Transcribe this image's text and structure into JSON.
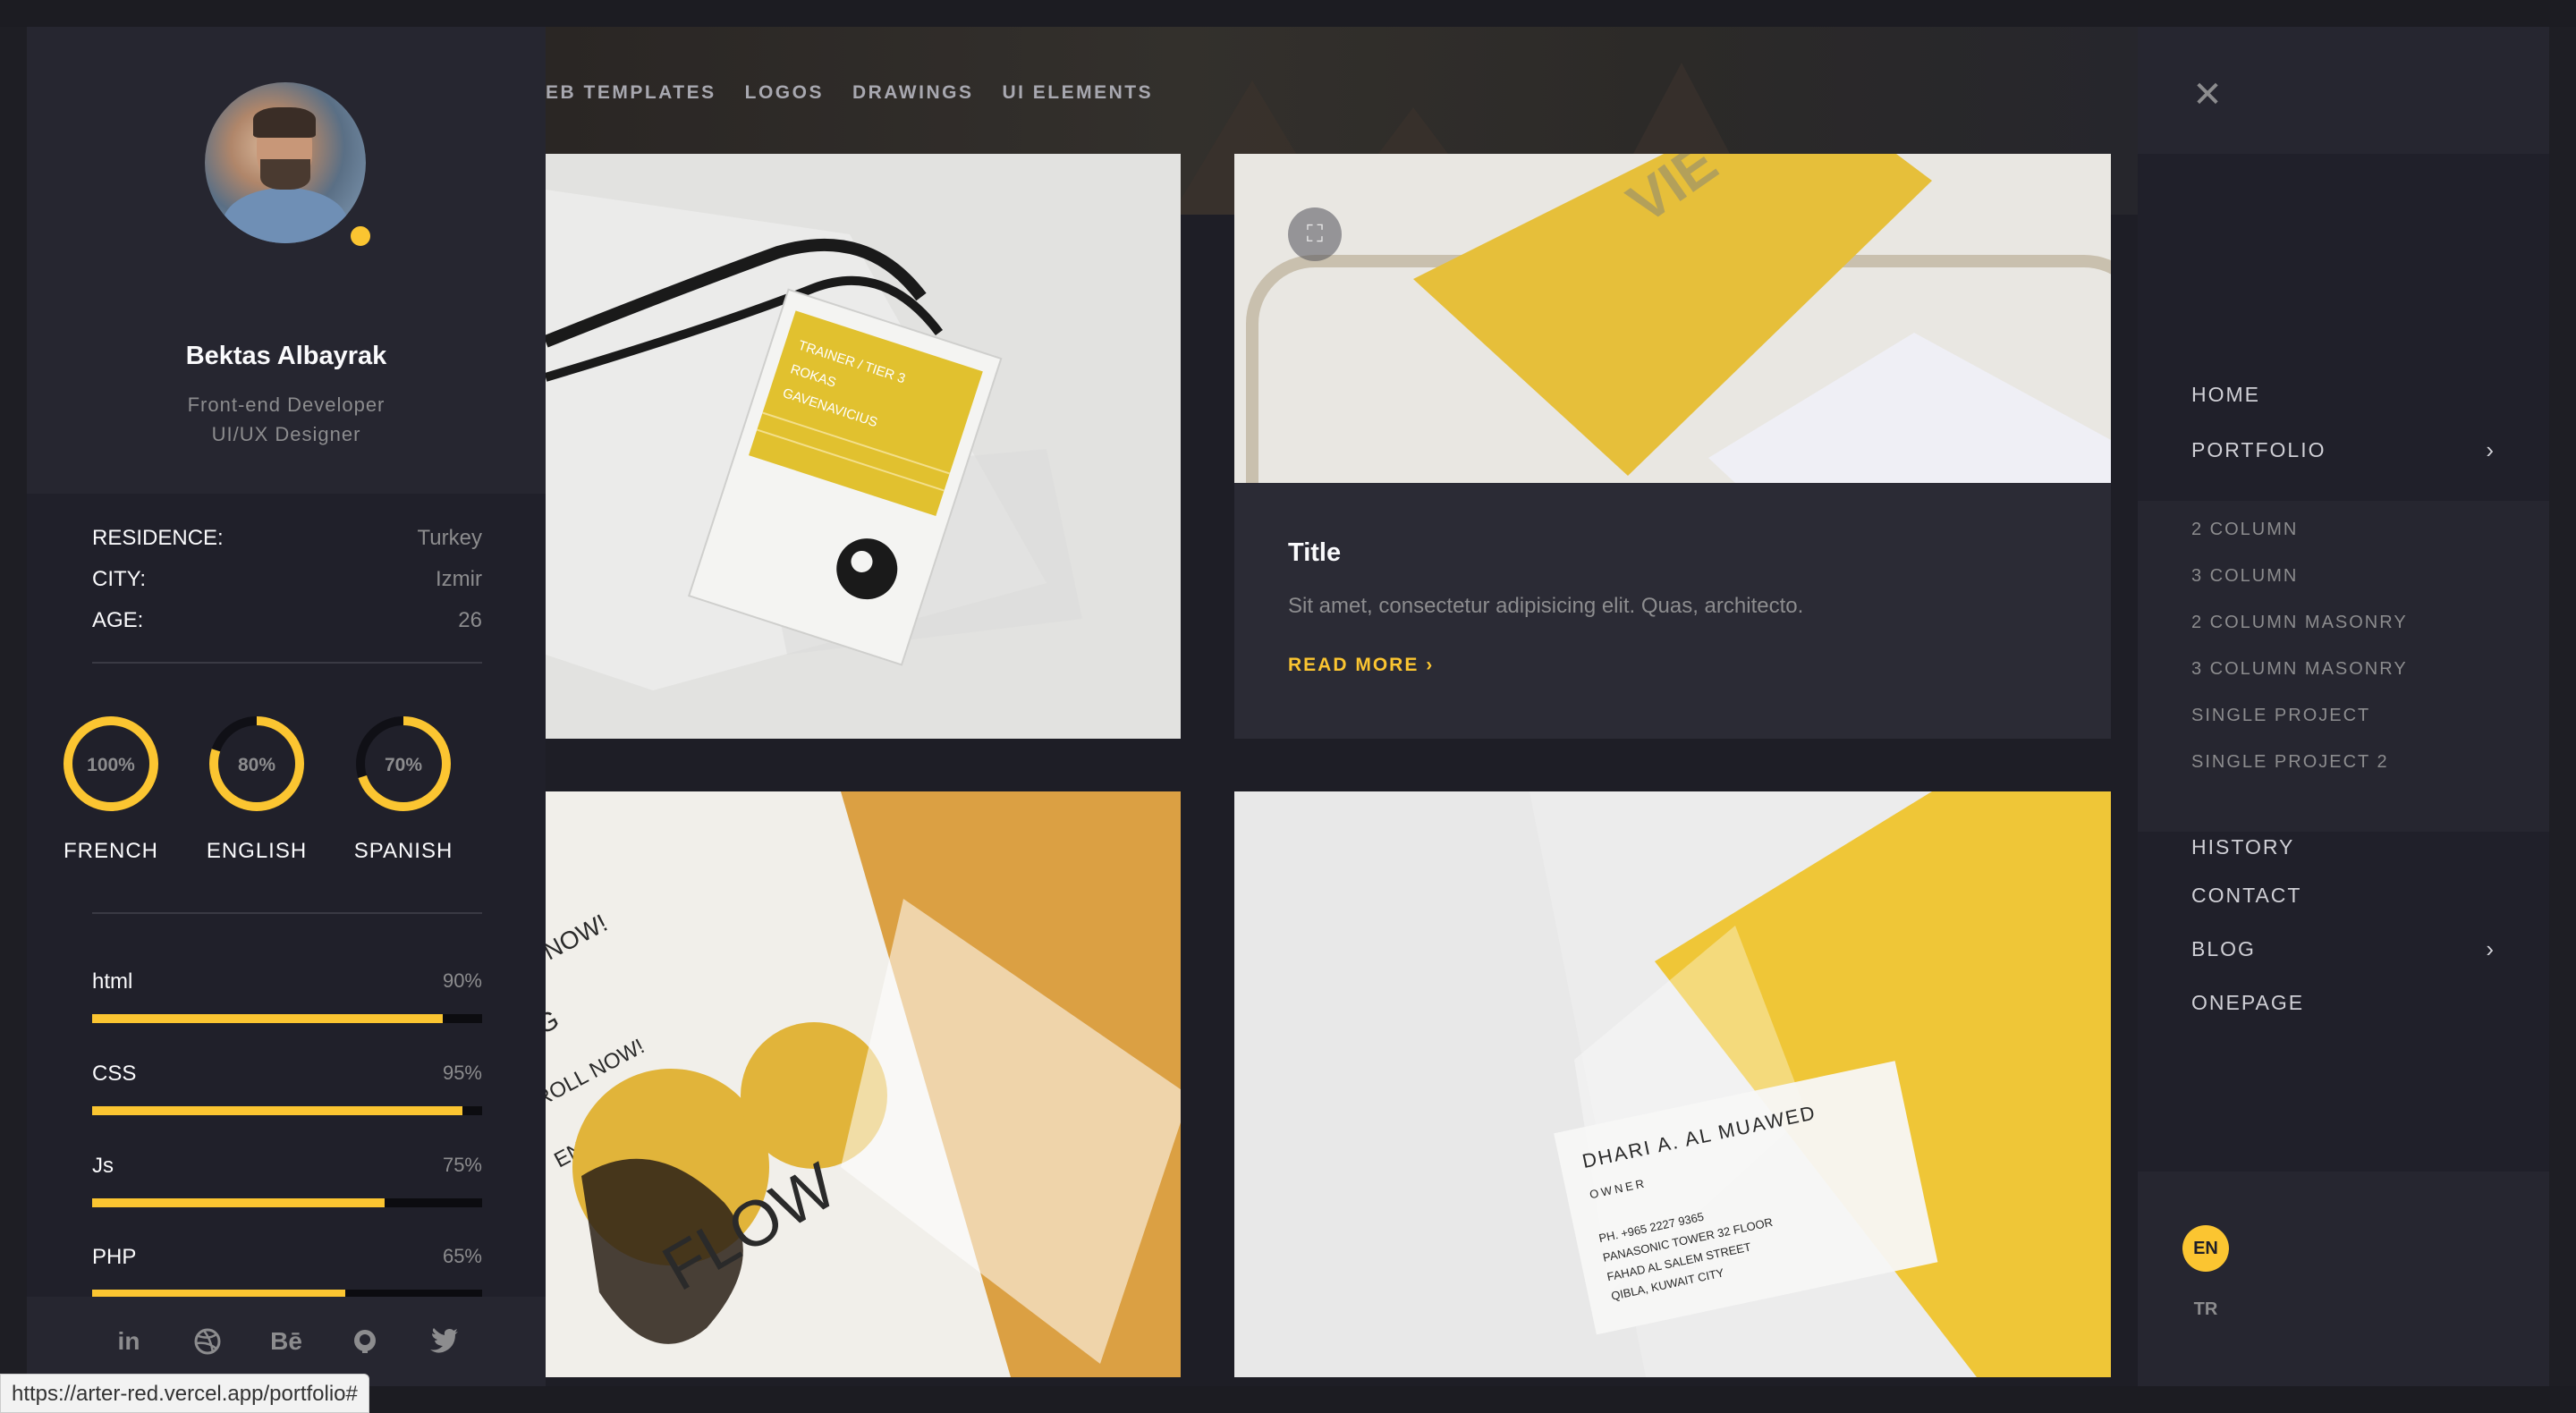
{
  "profile": {
    "name": "Bektas Albayrak",
    "role_line1": "Front-end Developer",
    "role_line2": "UI/UX Designer"
  },
  "info": [
    {
      "key": "RESIDENCE:",
      "value": "Turkey"
    },
    {
      "key": "CITY:",
      "value": "Izmir"
    },
    {
      "key": "AGE:",
      "value": "26"
    }
  ],
  "languages": [
    {
      "name": "FRENCH",
      "percent_label": "100%",
      "percent": 100
    },
    {
      "name": "ENGLISH",
      "percent_label": "80%",
      "percent": 80
    },
    {
      "name": "SPANISH",
      "percent_label": "70%",
      "percent": 70
    }
  ],
  "skills": [
    {
      "name": "html",
      "value_label": "90%",
      "percent": 90
    },
    {
      "name": "CSS",
      "value_label": "95%",
      "percent": 95
    },
    {
      "name": "Js",
      "value_label": "75%",
      "percent": 75
    },
    {
      "name": "PHP",
      "value_label": "65%",
      "percent": 65
    }
  ],
  "socials": {
    "linkedin": "in",
    "dribbble": "dribbble-icon",
    "behance": "Bē",
    "github": "github-icon",
    "twitter": "twitter-icon"
  },
  "filters": [
    "EB TEMPLATES",
    "LOGOS",
    "DRAWINGS",
    "UI ELEMENTS"
  ],
  "card2": {
    "title": "Title",
    "text": "Sit amet, consectetur adipisicing elit. Quas, architecto.",
    "more": "READ MORE"
  },
  "card4": {
    "card_name": "DHARI A. AL MUAWED",
    "card_title": "OWNER",
    "card_line1": "PH. +965 2227 9365",
    "card_line2": "PANASONIC TOWER 32 FLOOR",
    "card_line3": "FAHAD AL SALEM STREET",
    "card_line4": "QIBLA, KUWAIT CITY"
  },
  "card1": {
    "badge_line1": "TRAINER / TIER 3",
    "badge_line2": "ROKAS",
    "badge_line3": "GAVENAVICIUS"
  },
  "card3": {
    "text1": "ENROLL NOW!",
    "text2": "BOXING",
    "text3": "FLOW"
  },
  "menu": {
    "home": "HOME",
    "portfolio": "PORTFOLIO",
    "sub": [
      "2 COLUMN",
      "3 COLUMN",
      "2 COLUMN MASONRY",
      "3 COLUMN MASONRY",
      "SINGLE PROJECT",
      "SINGLE PROJECT 2"
    ],
    "history": "HISTORY",
    "contact": "CONTACT",
    "blog": "BLOG",
    "onepage": "ONEPAGE"
  },
  "lang_switch": {
    "en": "EN",
    "tr": "TR"
  },
  "status_url": "https://arter-red.vercel.app/portfolio#",
  "colors": {
    "accent": "#fbc531",
    "panel": "#20202a",
    "panel_light": "#262630"
  }
}
